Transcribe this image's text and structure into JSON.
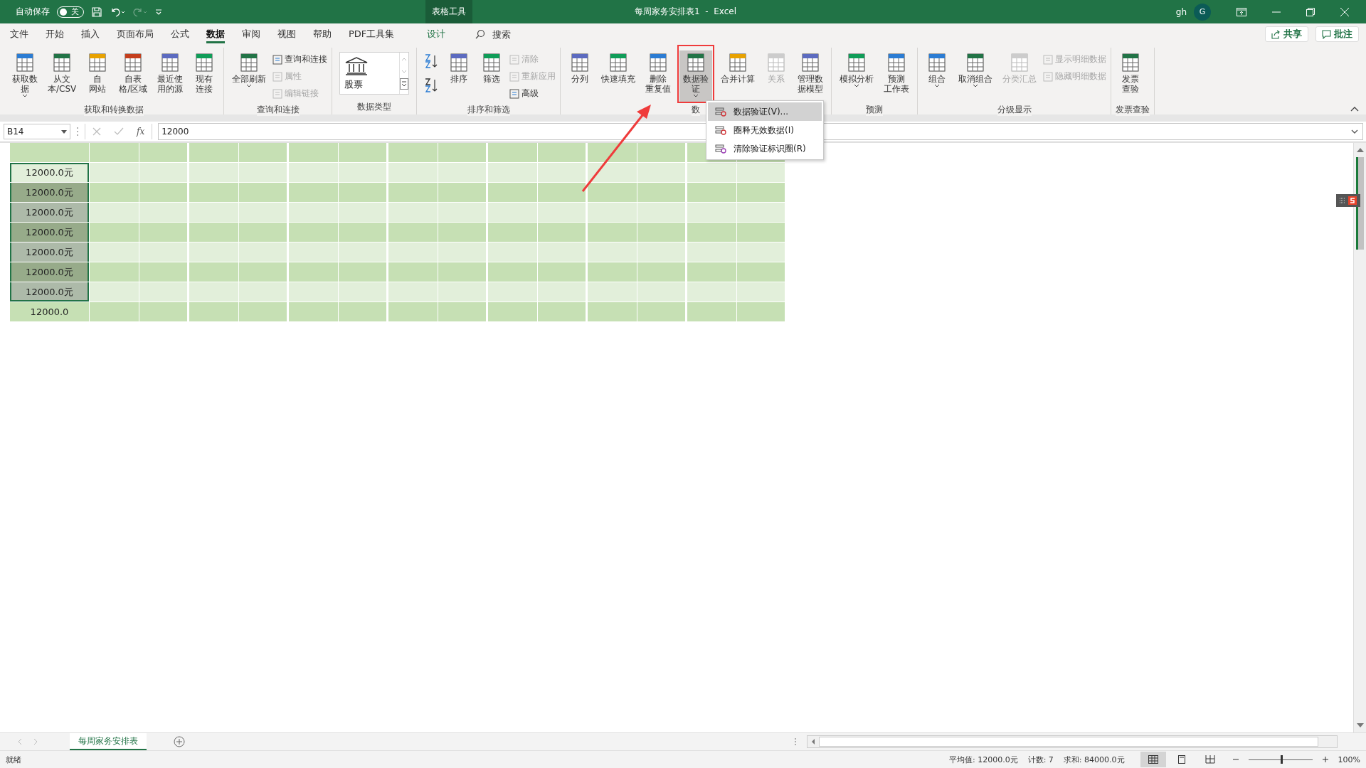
{
  "titlebar": {
    "autosave_label": "自动保存",
    "autosave_state": "关",
    "autosave_on": false,
    "context_tab": "表格工具",
    "title": "每周家务安排表1  -  Excel",
    "user": "gh",
    "avatar": "G"
  },
  "menu_tabs": [
    {
      "label": "文件",
      "selected": false,
      "kind": "normal"
    },
    {
      "label": "开始",
      "selected": false,
      "kind": "normal"
    },
    {
      "label": "插入",
      "selected": false,
      "kind": "normal"
    },
    {
      "label": "页面布局",
      "selected": false,
      "kind": "normal"
    },
    {
      "label": "公式",
      "selected": false,
      "kind": "normal"
    },
    {
      "label": "数据",
      "selected": true,
      "kind": "normal"
    },
    {
      "label": "审阅",
      "selected": false,
      "kind": "normal"
    },
    {
      "label": "视图",
      "selected": false,
      "kind": "normal"
    },
    {
      "label": "帮助",
      "selected": false,
      "kind": "normal"
    },
    {
      "label": "PDF工具集",
      "selected": false,
      "kind": "normal"
    },
    {
      "label": "设计",
      "selected": false,
      "kind": "contextual"
    }
  ],
  "search": {
    "placeholder": "搜索"
  },
  "share_button": "共享",
  "comments_button": "批注",
  "ribbon_groups": [
    {
      "label": "获取和转换数据",
      "items": [
        {
          "kind": "large",
          "lines": [
            "获取数",
            "据"
          ],
          "dropdown": true,
          "disabled": false,
          "pressed": false
        },
        {
          "kind": "large",
          "lines": [
            "从文",
            "本/CSV"
          ],
          "dropdown": false,
          "disabled": false,
          "pressed": false
        },
        {
          "kind": "large",
          "lines": [
            "自",
            "网站"
          ],
          "dropdown": false,
          "disabled": false,
          "pressed": false
        },
        {
          "kind": "large",
          "lines": [
            "自表",
            "格/区域"
          ],
          "dropdown": false,
          "disabled": false,
          "pressed": false
        },
        {
          "kind": "large",
          "lines": [
            "最近使",
            "用的源"
          ],
          "dropdown": false,
          "disabled": false,
          "pressed": false
        },
        {
          "kind": "large",
          "lines": [
            "现有",
            "连接"
          ],
          "dropdown": false,
          "disabled": false,
          "pressed": false
        }
      ]
    },
    {
      "label": "查询和连接",
      "items": [
        {
          "kind": "large",
          "lines": [
            "全部刷新"
          ],
          "dropdown": true,
          "disabled": false,
          "pressed": false
        },
        {
          "kind": "stack",
          "items": [
            {
              "label": "查询和连接",
              "disabled": false
            },
            {
              "label": "属性",
              "disabled": true
            },
            {
              "label": "编辑链接",
              "disabled": true
            }
          ]
        }
      ]
    },
    {
      "label": "数据类型",
      "items": [
        {
          "kind": "gallery",
          "label": "股票"
        }
      ]
    },
    {
      "label": "排序和筛选",
      "items": [
        {
          "kind": "sort",
          "items": [
            {
              "kind": "ascending"
            },
            {
              "kind": "descending"
            }
          ]
        },
        {
          "kind": "large",
          "lines": [
            "排序"
          ],
          "dropdown": false,
          "disabled": false,
          "pressed": false
        },
        {
          "kind": "large",
          "lines": [
            "筛选"
          ],
          "dropdown": false,
          "disabled": false,
          "pressed": false
        },
        {
          "kind": "stack",
          "items": [
            {
              "label": "清除",
              "disabled": true
            },
            {
              "label": "重新应用",
              "disabled": true
            },
            {
              "label": "高级",
              "disabled": false
            }
          ]
        }
      ]
    },
    {
      "label": "数",
      "items": [
        {
          "kind": "large",
          "lines": [
            "分列"
          ],
          "dropdown": false,
          "disabled": false,
          "pressed": false
        },
        {
          "kind": "large",
          "lines": [
            "快速填充"
          ],
          "dropdown": false,
          "disabled": false,
          "pressed": false
        },
        {
          "kind": "large",
          "lines": [
            "删除",
            "重复值"
          ],
          "dropdown": false,
          "disabled": false,
          "pressed": false
        },
        {
          "kind": "large",
          "lines": [
            "数据验",
            "证"
          ],
          "dropdown": true,
          "disabled": false,
          "pressed": true
        },
        {
          "kind": "large",
          "lines": [
            "合并计算"
          ],
          "dropdown": false,
          "disabled": false,
          "pressed": false
        },
        {
          "kind": "large",
          "lines": [
            "关系"
          ],
          "dropdown": false,
          "disabled": true,
          "pressed": false
        },
        {
          "kind": "large",
          "lines": [
            "管理数",
            "据模型"
          ],
          "dropdown": false,
          "disabled": false,
          "pressed": false
        }
      ]
    },
    {
      "label": "预测",
      "items": [
        {
          "kind": "large",
          "lines": [
            "模拟分析"
          ],
          "dropdown": true,
          "disabled": false,
          "pressed": false
        },
        {
          "kind": "large",
          "lines": [
            "预测",
            "工作表"
          ],
          "dropdown": false,
          "disabled": false,
          "pressed": false
        }
      ]
    },
    {
      "label": "分级显示",
      "items": [
        {
          "kind": "large",
          "lines": [
            "组合"
          ],
          "dropdown": true,
          "disabled": false,
          "pressed": false
        },
        {
          "kind": "large",
          "lines": [
            "取消组合"
          ],
          "dropdown": true,
          "disabled": false,
          "pressed": false
        },
        {
          "kind": "large",
          "lines": [
            "分类汇总"
          ],
          "dropdown": false,
          "disabled": true,
          "pressed": false
        },
        {
          "kind": "stack",
          "items": [
            {
              "label": "显示明细数据",
              "disabled": true
            },
            {
              "label": "隐藏明细数据",
              "disabled": true
            }
          ]
        }
      ]
    },
    {
      "label": "发票查验",
      "items": [
        {
          "kind": "large",
          "lines": [
            "发票",
            "查验"
          ],
          "dropdown": false,
          "disabled": false,
          "pressed": false
        }
      ]
    }
  ],
  "dropdown_menu": [
    {
      "label": "数据验证(V)...",
      "selected": true
    },
    {
      "label": "圈释无效数据(I)",
      "selected": false
    },
    {
      "label": "清除验证标识圈(R)",
      "selected": false
    }
  ],
  "formula_bar": {
    "name_box": "B14",
    "fx": "fx",
    "formula": "12000"
  },
  "grid": {
    "rows": [
      {
        "value": "12000.0元",
        "selected": true,
        "active": true
      },
      {
        "value": "12000.0元",
        "selected": true,
        "active": false
      },
      {
        "value": "12000.0元",
        "selected": true,
        "active": false
      },
      {
        "value": "12000.0元",
        "selected": true,
        "active": false
      },
      {
        "value": "12000.0元",
        "selected": true,
        "active": false
      },
      {
        "value": "12000.0元",
        "selected": true,
        "active": false
      },
      {
        "value": "12000.0元",
        "selected": true,
        "active": false
      },
      {
        "value": "12000.0",
        "selected": false,
        "active": false
      }
    ]
  },
  "sheet_tabs": [
    {
      "label": "每周家务安排表",
      "selected": true
    }
  ],
  "status_bar": {
    "status": "就绪",
    "average": "平均值: 12000.0元",
    "count": "计数: 7",
    "sum": "求和: 84000.0元",
    "zoom": "100%",
    "zoom_slider": {
      "level": 0.5
    },
    "views": [
      {
        "kind": "normal",
        "selected": true
      },
      {
        "kind": "layout",
        "selected": false
      },
      {
        "kind": "pagebreak",
        "selected": false
      }
    ]
  },
  "annotations": {
    "highlight_frame": true,
    "arrow": true
  }
}
